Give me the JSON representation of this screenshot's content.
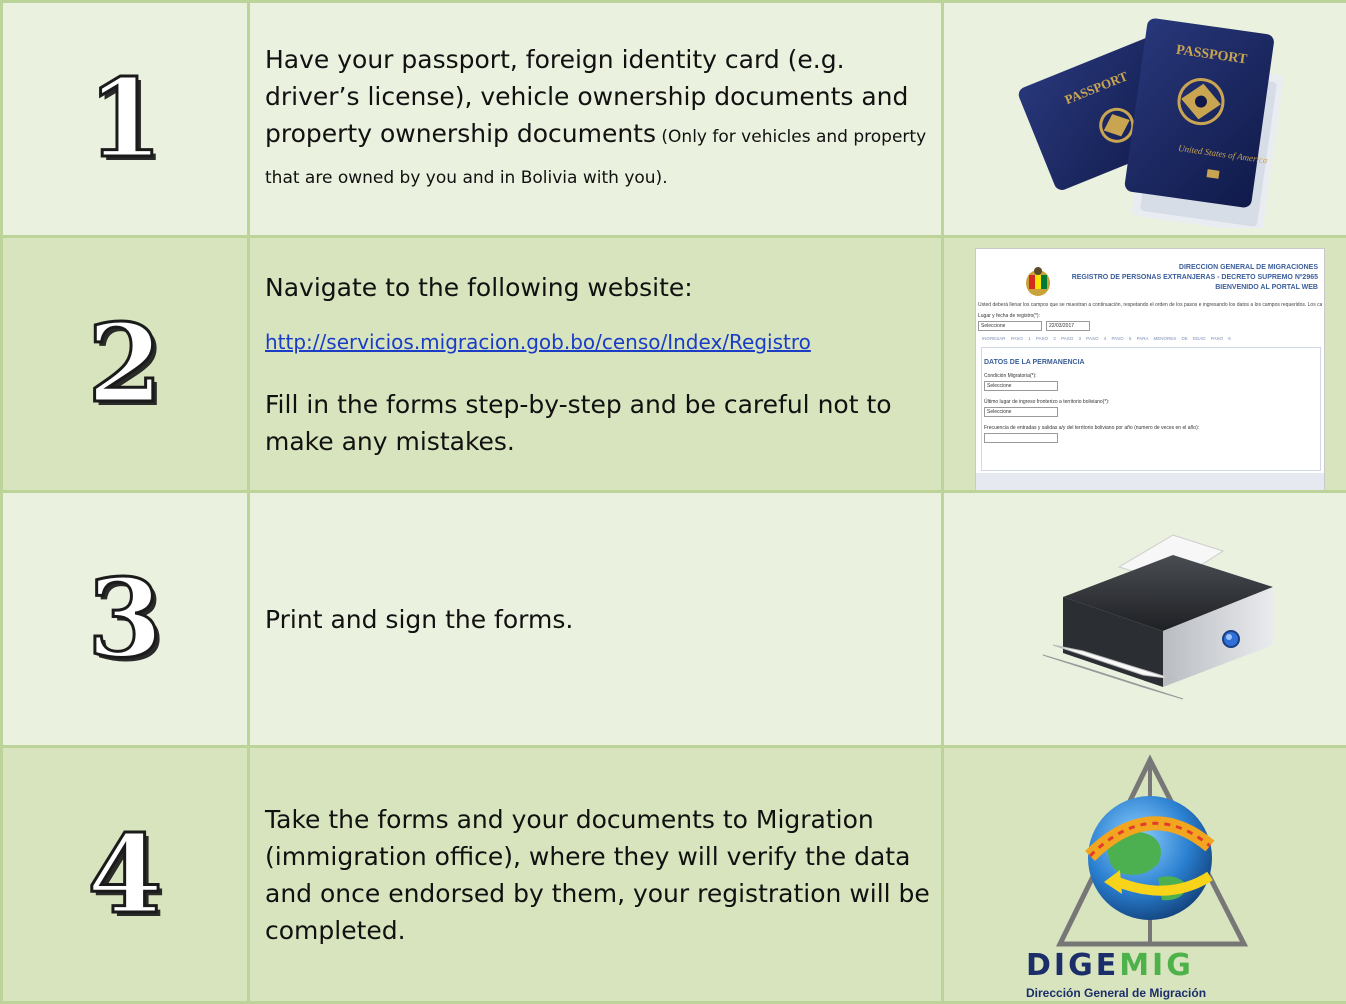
{
  "steps": [
    {
      "number": "1",
      "text_main": "Have your passport, foreign identity card (e.g. driver’s license), vehicle ownership documents and property ownership documents",
      "text_note": " (Only for vehicles and property that are owned by you and in Bolivia with you).",
      "image": "passport-image",
      "image_text": {
        "passport_left": "PASSPORT",
        "passport_right": "PASSPORT",
        "cover": "United States of America"
      }
    },
    {
      "number": "2",
      "text_intro": "Navigate to the following website:",
      "link": "http://servicios.migracion.gob.bo/censo/Index/Registro",
      "text_after": "Fill in the forms step-by-step and be careful not to make any mistakes.",
      "image": "website-screenshot",
      "site": {
        "header_lines": [
          "DIRECCION GENERAL DE MIGRACIONES",
          "REGISTRO DE PERSONAS EXTRANJERAS - DECRETO SUPREMO Nº2965",
          "BIENVENIDO AL PORTAL WEB"
        ],
        "intro": "Usted deberá llenar los campos que se muestran a continuación, respetando el orden de los pasos e ingresando los datos a los campos requeridos. Los campos con * son obligatorios",
        "place_label": "Lugar y fecha de registro(*):",
        "place_value": "Seleccione",
        "date_value": "22/03/2017",
        "tabs": "INGRESAR PASO 1 PASO 2 PASO 3 PASO 4 PASO 5 PARA MENORES DE EDAD PASO 6",
        "section_title": "DATOS DE LA PERMANENCIA",
        "field1_label": "Condición Migratoria(*):",
        "field1_value": "Seleccione",
        "field2_label": "Último lugar de ingreso fronterizo a territorio boliviano(*):",
        "field2_value": "Seleccione",
        "field3_label": "Frecuencia de entradas y salidas a/y del territorio boliviano por año (numero de veces en el año):"
      }
    },
    {
      "number": "3",
      "text_main": "Print and sign the forms.",
      "image": "printer-image"
    },
    {
      "number": "4",
      "text_main": "Take the forms and your documents to Migration (immigration office), where they will verify the data and once endorsed by them, your registration will be completed.",
      "image": "digemig-logo",
      "logo_main_a": "DIGE",
      "logo_main_b": "MIG",
      "logo_sub": "Dirección General de Migración"
    }
  ],
  "colors": {
    "border": "#bcd39a",
    "row_light": "#eaf1de",
    "row_dark": "#d7e4bd",
    "link": "#1a3cc7"
  }
}
